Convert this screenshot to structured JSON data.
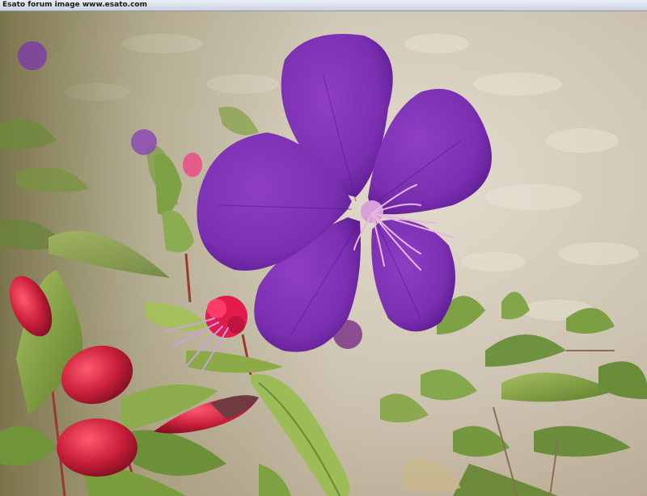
{
  "caption": {
    "text": "Esato forum image www.esato.com"
  },
  "photo": {
    "subject": "purple flower with red buds and green leaves over paving stones",
    "colors": {
      "petal": "#7a2fb0",
      "petal_dark": "#5a1a8c",
      "stamen": "#e6b8e0",
      "bud": "#c81e3a",
      "leaf": "#7fa042",
      "ground": "#cfc6b6"
    }
  }
}
